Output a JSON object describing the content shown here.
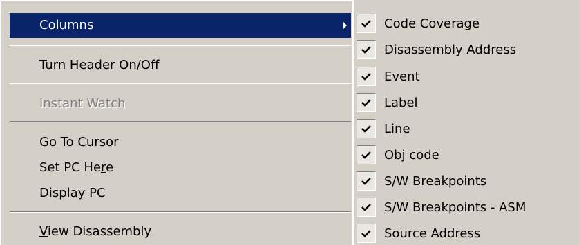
{
  "menu": {
    "items": [
      {
        "pre": "Co",
        "u": "l",
        "post": "umns",
        "selected": true,
        "disabled": false,
        "submenu": true
      },
      {
        "pre": "Turn ",
        "u": "H",
        "post": "eader On/Off",
        "selected": false,
        "disabled": false,
        "submenu": false
      },
      {
        "pre": "Instant Watch",
        "u": "",
        "post": "",
        "selected": false,
        "disabled": true,
        "submenu": false
      },
      {
        "pre": "Go To C",
        "u": "u",
        "post": "rsor",
        "selected": false,
        "disabled": false,
        "submenu": false
      },
      {
        "pre": "Set PC He",
        "u": "r",
        "post": "e",
        "selected": false,
        "disabled": false,
        "submenu": false
      },
      {
        "pre": "Displa",
        "u": "y",
        "post": " PC",
        "selected": false,
        "disabled": false,
        "submenu": false
      },
      {
        "pre": "",
        "u": "V",
        "post": "iew Disassembly",
        "selected": false,
        "disabled": false,
        "submenu": false
      }
    ]
  },
  "columns_submenu": {
    "items": [
      {
        "label": "Code Coverage",
        "checked": true
      },
      {
        "label": "Disassembly Address",
        "checked": true
      },
      {
        "label": "Event",
        "checked": true
      },
      {
        "label": "Label",
        "checked": true
      },
      {
        "label": "Line",
        "checked": true
      },
      {
        "label": "Obj code",
        "checked": true
      },
      {
        "label": "S/W Breakpoints",
        "checked": true
      },
      {
        "label": "S/W Breakpoints - ASM",
        "checked": true
      },
      {
        "label": "Source Address",
        "checked": true
      }
    ]
  },
  "colors": {
    "menu_bg": "#d4d0c8",
    "highlight": "#0a246a",
    "highlight_text": "#ffffff",
    "disabled_text": "#808080"
  }
}
